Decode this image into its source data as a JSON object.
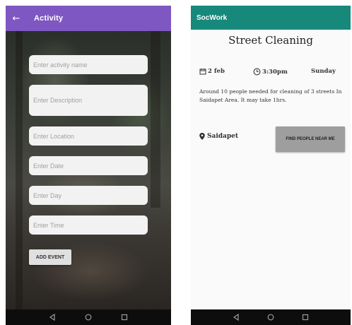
{
  "left_screen": {
    "appbar": {
      "title": "Activity",
      "back_icon": "arrow-back-icon"
    },
    "form": {
      "activity_name_placeholder": "Enter activity name",
      "description_placeholder": "Enter Description",
      "location_placeholder": "Enter Location",
      "date_placeholder": "Enter Date",
      "day_placeholder": "Enter Day",
      "time_placeholder": "Enter Time",
      "add_event_label": "ADD EVENT"
    },
    "colors": {
      "appbar": "#7e57c2"
    }
  },
  "right_screen": {
    "appbar": {
      "title": "SocWork"
    },
    "event": {
      "title": "Street Cleaning",
      "date": "2 feb",
      "time": "3:30pm",
      "day": "Sunday",
      "description": "Around 10 people needed for cleaning of 3 streets In Saidapet Area. It may take 1hrs.",
      "location": "Saidapet",
      "find_people_label": "FIND PEOPLE NEAR ME"
    },
    "colors": {
      "appbar": "#16897a"
    }
  },
  "navbar": {
    "icons": [
      "back-triangle-icon",
      "home-circle-icon",
      "recents-square-icon"
    ]
  }
}
